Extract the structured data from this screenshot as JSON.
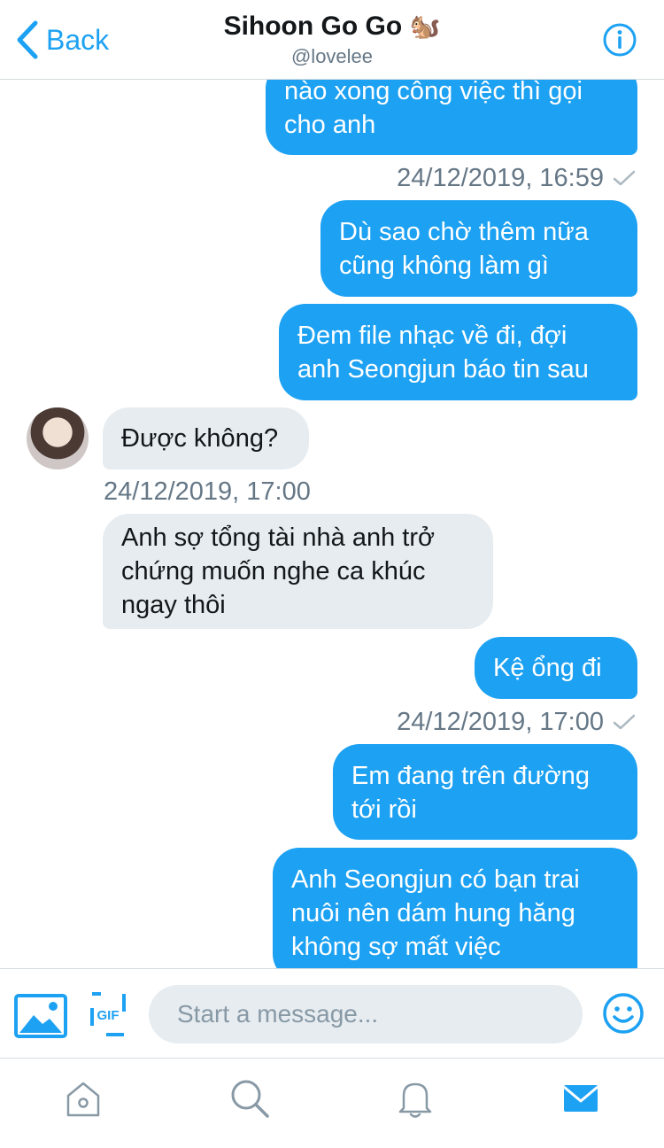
{
  "header": {
    "back_label": "Back",
    "title": "Sihoon Go Go",
    "title_emoji": "🐿️",
    "handle": "@lovelee"
  },
  "messages": [
    {
      "direction": "out",
      "text": "nào xong công việc thì gọi\ncho anh"
    },
    {
      "timestamp": "24/12/2019, 16:59",
      "read": true
    },
    {
      "direction": "out",
      "text": "Dù sao chờ thêm nữa\ncũng không làm gì"
    },
    {
      "direction": "out",
      "text": "Đem file nhạc về đi, đợi\nanh Seongjun báo tin sau"
    },
    {
      "direction": "in",
      "text": "Được không?"
    },
    {
      "timestamp": "24/12/2019, 17:00"
    },
    {
      "direction": "in",
      "text": "Anh sợ tổng tài nhà anh trở\nchứng muốn nghe ca khúc\nngay thôi"
    },
    {
      "direction": "out",
      "text": "Kệ ổng đi"
    },
    {
      "timestamp": "24/12/2019, 17:00",
      "read": true
    },
    {
      "direction": "out",
      "text": "Em đang trên đường\ntới rồi"
    },
    {
      "direction": "out",
      "text": "Anh Seongjun có bạn trai\nnuôi nên dám hung hăng\nkhông sợ mất việc"
    }
  ],
  "composer": {
    "placeholder": "Start a message...",
    "gif_label": "GIF"
  },
  "tabs": [
    "home-icon",
    "search-icon",
    "notifications-icon",
    "messages-icon"
  ],
  "colors": {
    "accent": "#1da1f2",
    "incoming_bubble": "#e6ecf0",
    "muted_text": "#657786",
    "inactive_icon": "#8899a6"
  }
}
